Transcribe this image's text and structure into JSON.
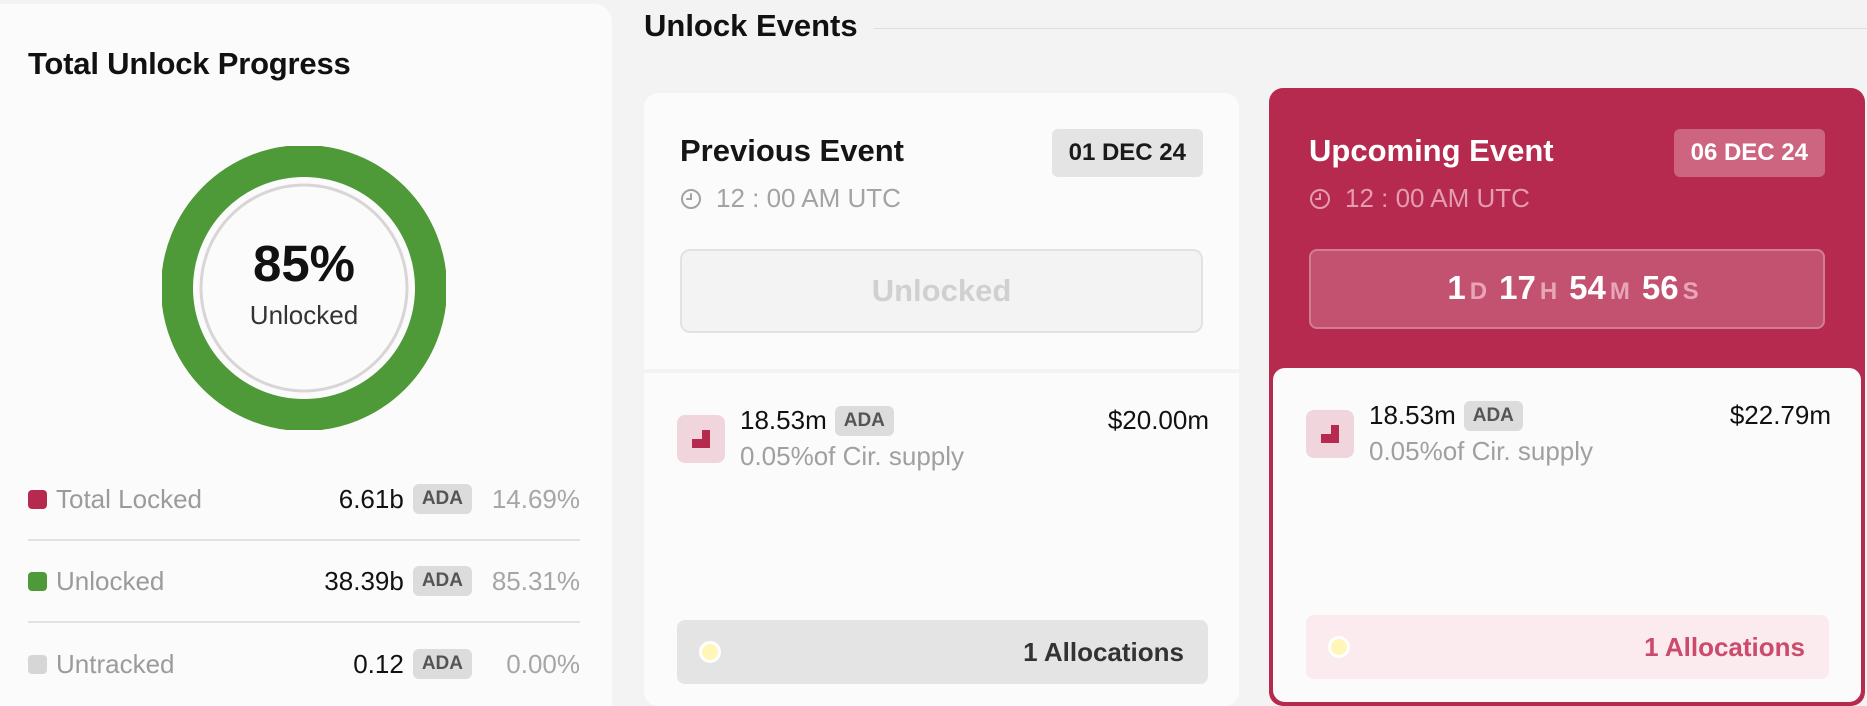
{
  "left": {
    "title": "Total Unlock Progress",
    "progress_percent": 85,
    "progress_text": "85%",
    "progress_label": "Unlocked",
    "legend": [
      {
        "name": "Total Locked",
        "value": "6.61b",
        "token": "ADA",
        "pct": "14.69%",
        "color": "#b72a50"
      },
      {
        "name": "Unlocked",
        "value": "38.39b",
        "token": "ADA",
        "pct": "85.31%",
        "color": "#4f9a38"
      },
      {
        "name": "Untracked",
        "value": "0.12",
        "token": "ADA",
        "pct": "0.00%",
        "color": "#d6d6d6"
      }
    ]
  },
  "events": {
    "title": "Unlock Events",
    "previous": {
      "title": "Previous Event",
      "date": "01 DEC 24",
      "time": "12 : 00 AM UTC",
      "status": "Unlocked",
      "amount": "18.53m",
      "token": "ADA",
      "supply": "0.05%of Cir. supply",
      "usd": "$20.00m",
      "allocations": "1 Allocations"
    },
    "upcoming": {
      "title": "Upcoming Event",
      "date": "06 DEC 24",
      "time": "12 : 00 AM UTC",
      "countdown": {
        "days": "1",
        "hours": "17",
        "minutes": "54",
        "seconds": "56",
        "d": "D",
        "h": "H",
        "m": "M",
        "s": "S"
      },
      "amount": "18.53m",
      "token": "ADA",
      "supply": "0.05%of Cir. supply",
      "usd": "$22.79m",
      "allocations": "1 Allocations"
    }
  },
  "colors": {
    "accent": "#b72a50",
    "unlocked": "#4f9a38",
    "untracked": "#d6d6d6"
  },
  "icons": [
    "clock-icon",
    "token-icon",
    "allocation-dot-icon"
  ]
}
